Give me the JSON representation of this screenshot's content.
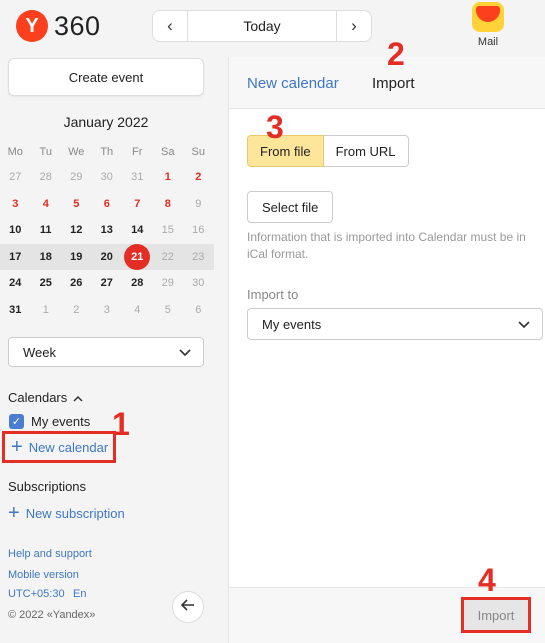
{
  "header": {
    "logo_letter": "Y",
    "logo_text": "360",
    "prev_icon": "chevron-left",
    "next_icon": "chevron-right",
    "today_label": "Today",
    "mail_label": "Mail"
  },
  "sidebar": {
    "create_event": "Create event",
    "month_title": "January 2022",
    "weekdays": [
      "Mo",
      "Tu",
      "We",
      "Th",
      "Fr",
      "Sa",
      "Su"
    ],
    "weeks": [
      [
        "27",
        "28",
        "29",
        "30",
        "31",
        "1",
        "2"
      ],
      [
        "3",
        "4",
        "5",
        "6",
        "7",
        "8",
        "9"
      ],
      [
        "10",
        "11",
        "12",
        "13",
        "14",
        "15",
        "16"
      ],
      [
        "17",
        "18",
        "19",
        "20",
        "21",
        "22",
        "23"
      ],
      [
        "24",
        "25",
        "26",
        "27",
        "28",
        "29",
        "30"
      ],
      [
        "31",
        "1",
        "2",
        "3",
        "4",
        "5",
        "6"
      ]
    ],
    "view_select": "Week",
    "calendars_heading": "Calendars",
    "calendar_items": [
      {
        "label": "My events",
        "checked": true
      }
    ],
    "new_calendar": "New calendar",
    "subscriptions_heading": "Subscriptions",
    "new_subscription": "New subscription",
    "help": "Help and support",
    "mobile": "Mobile version",
    "timezone": "UTC+05:30",
    "language": "En",
    "copyright": "© 2022 «Yandex»"
  },
  "panel": {
    "tab_new": "New calendar",
    "tab_import": "Import",
    "from_file": "From file",
    "from_url": "From URL",
    "select_file": "Select file",
    "info": "Information that is imported into Calendar must be in iCal format.",
    "import_to_label": "Import to",
    "import_to_value": "My events",
    "import_button": "Import"
  },
  "annotations": [
    "1",
    "2",
    "3",
    "4"
  ],
  "colors": {
    "accent_red": "#e42d24",
    "link_blue": "#3e77c6",
    "active_segment": "#fde59a"
  }
}
